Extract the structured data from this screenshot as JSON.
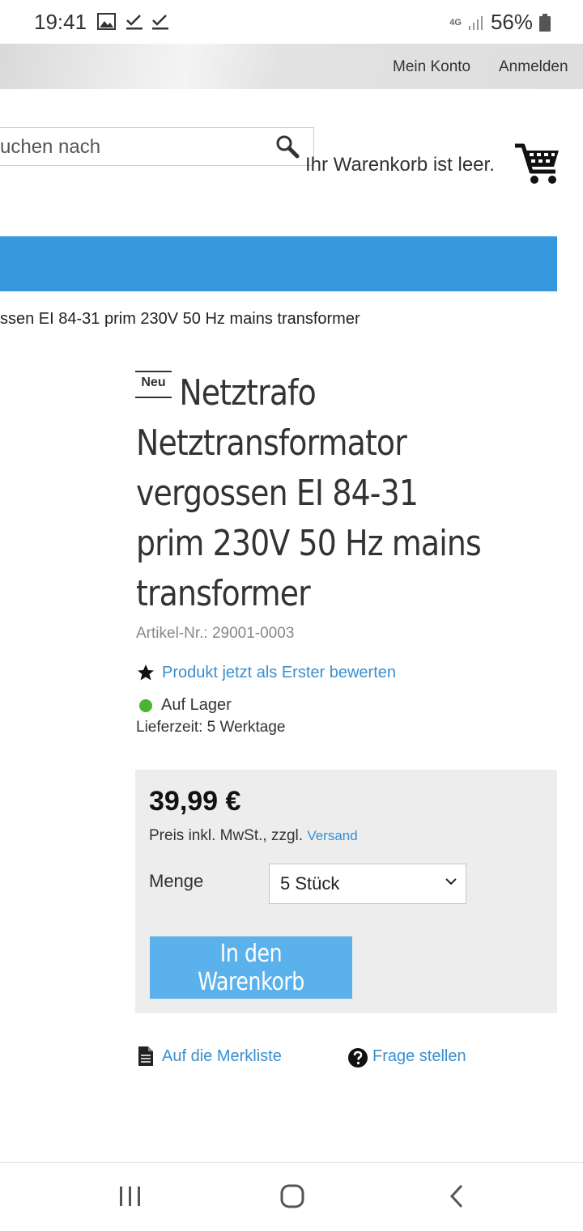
{
  "status_bar": {
    "time": "19:41",
    "network": "4G",
    "battery": "56%"
  },
  "header": {
    "account_link": "Mein Konto",
    "login_link": "Anmelden",
    "search_placeholder": "uchen nach",
    "cart_text": "Ihr Warenkorb ist leer."
  },
  "breadcrumb": "ssen EI 84-31 prim 230V 50 Hz mains transformer",
  "product": {
    "badge": "Neu",
    "title": "Netztrafo Netztransformator vergossen EI 84-31 prim 230V 50 Hz mains transformer",
    "article_no": "Artikel-Nr.: 29001-0003",
    "rate_link": "Produkt jetzt als Erster bewerten",
    "stock": "Auf Lager",
    "delivery": "Lieferzeit: 5 Werktage"
  },
  "buybox": {
    "price": "39,99 €",
    "vat_text": "Preis inkl. MwSt., zzgl.",
    "shipping_link": "Versand",
    "qty_label": "Menge",
    "qty_value": "5 Stück",
    "add_button": "In den Warenkorb"
  },
  "actions": {
    "wishlist": "Auf die Merkliste",
    "question": "Frage stellen"
  },
  "colors": {
    "accent": "#3699dd",
    "button": "#5bb1ec",
    "link": "#3a8fd0",
    "stock": "#4cb434"
  }
}
